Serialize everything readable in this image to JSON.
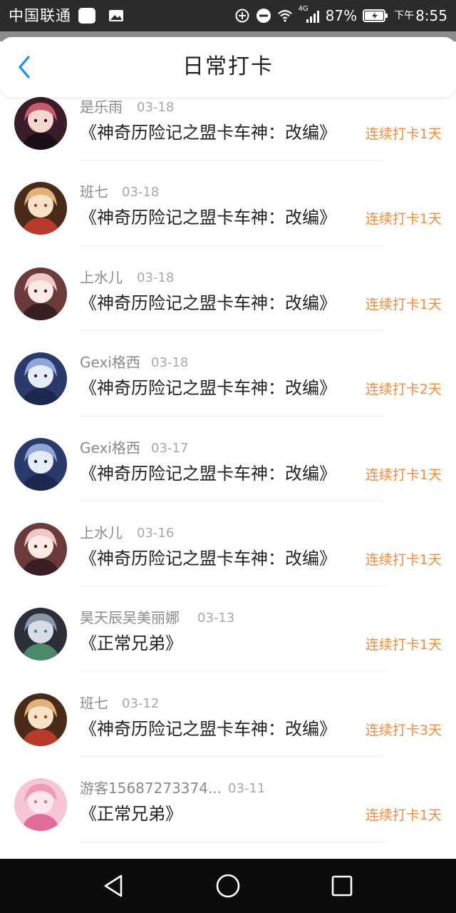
{
  "status_bar": {
    "carrier": "中国联通",
    "network": "4G",
    "battery": "87%",
    "ampm": "下午",
    "time": "8:55"
  },
  "header": {
    "title": "日常打卡"
  },
  "colors": {
    "accent_blue": "#1a8cff",
    "streak_orange": "#f08a3c"
  },
  "items": [
    {
      "user": "是乐雨",
      "date": "03-18",
      "work": "《神奇历险记之盟卡车神：改编》",
      "streak": "连续打卡1天"
    },
    {
      "user": "班七",
      "date": "03-18",
      "work": "《神奇历险记之盟卡车神：改编》",
      "streak": "连续打卡1天"
    },
    {
      "user": "上水儿",
      "date": "03-18",
      "work": "《神奇历险记之盟卡车神：改编》",
      "streak": "连续打卡1天"
    },
    {
      "user": "Gexi格西",
      "date": "03-18",
      "work": "《神奇历险记之盟卡车神：改编》",
      "streak": "连续打卡2天"
    },
    {
      "user": "Gexi格西",
      "date": "03-17",
      "work": "《神奇历险记之盟卡车神：改编》",
      "streak": "连续打卡1天"
    },
    {
      "user": "上水儿",
      "date": "03-16",
      "work": "《神奇历险记之盟卡车神：改编》",
      "streak": "连续打卡1天"
    },
    {
      "user": "昊天辰吴美丽娜",
      "date": "03-13",
      "work": "《正常兄弟》",
      "streak": "连续打卡1天"
    },
    {
      "user": "班七",
      "date": "03-12",
      "work": "《神奇历险记之盟卡车神：改编》",
      "streak": "连续打卡3天"
    },
    {
      "user": "游客15687273374...",
      "date": "03-11",
      "work": "《正常兄弟》",
      "streak": "连续打卡1天"
    }
  ]
}
